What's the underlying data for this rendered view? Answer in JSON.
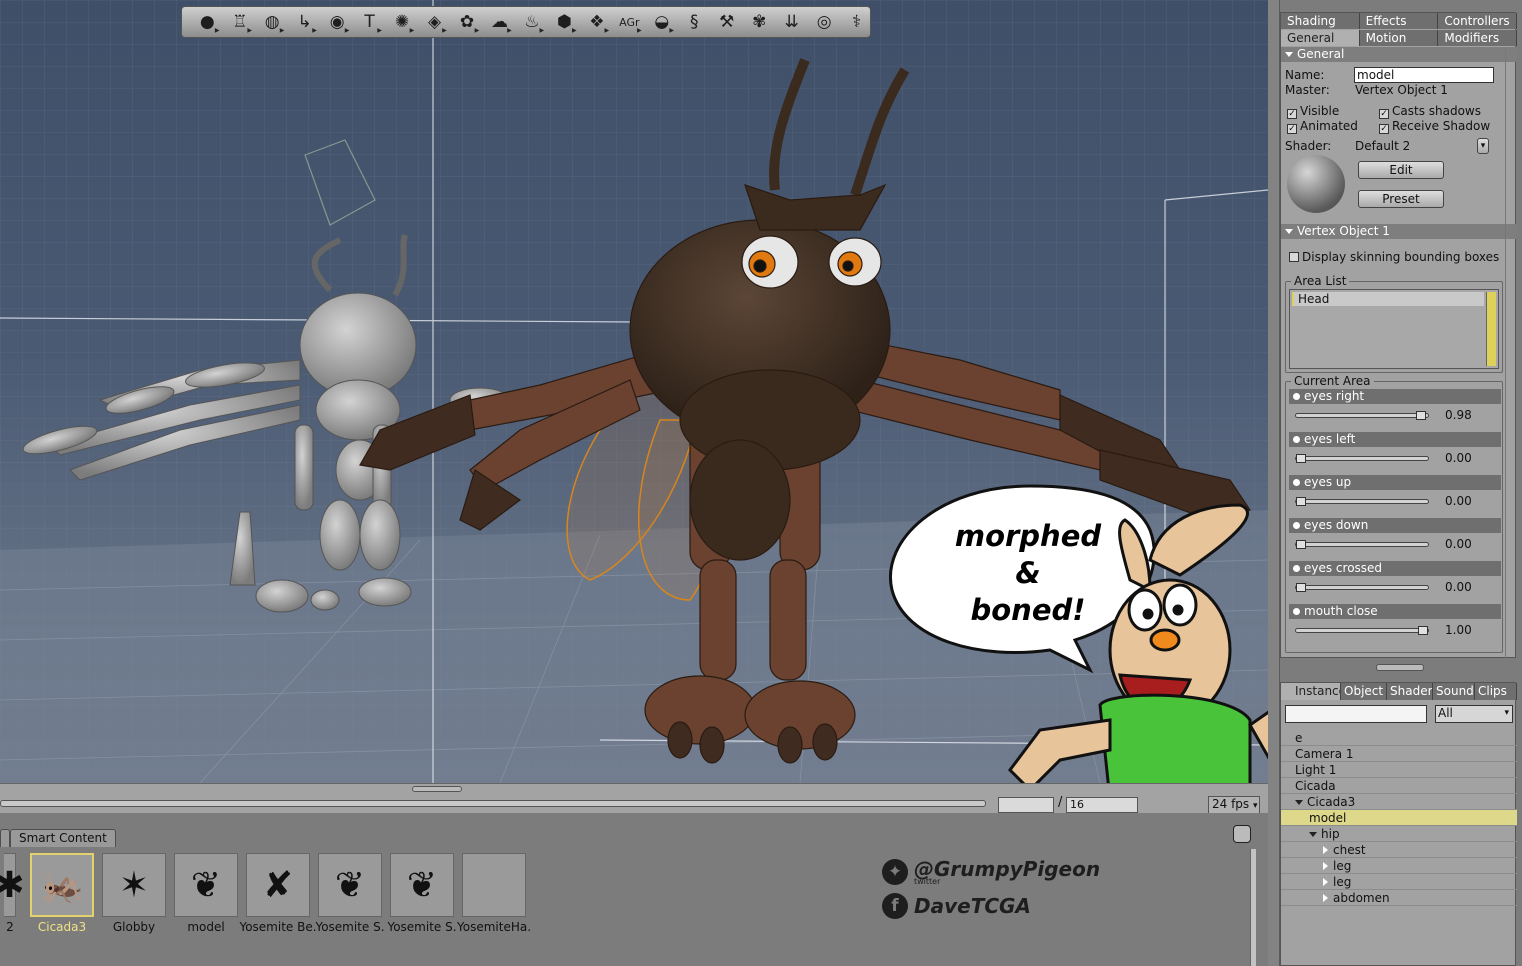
{
  "toolbar": {
    "tools": [
      {
        "name": "sphere-icon",
        "glyph": "●"
      },
      {
        "name": "goblet-icon",
        "glyph": "♖"
      },
      {
        "name": "globe-icon",
        "glyph": "◍"
      },
      {
        "name": "bend-icon",
        "glyph": "↳"
      },
      {
        "name": "eye-icon",
        "glyph": "◉"
      },
      {
        "name": "text-icon",
        "glyph": "T"
      },
      {
        "name": "gear-icon",
        "glyph": "✺"
      },
      {
        "name": "terrain-icon",
        "glyph": "◈"
      },
      {
        "name": "tree-icon",
        "glyph": "✿"
      },
      {
        "name": "cloud-icon",
        "glyph": "☁"
      },
      {
        "name": "flame-icon",
        "glyph": "♨"
      },
      {
        "name": "dice-icon",
        "glyph": "⬢"
      },
      {
        "name": "diamond-icon",
        "glyph": "❖"
      },
      {
        "name": "agr-icon",
        "glyph": "AGr"
      },
      {
        "name": "bowl-icon",
        "glyph": "◒"
      },
      {
        "name": "spring-icon",
        "glyph": "§"
      },
      {
        "name": "hammer-icon",
        "glyph": "⚒"
      },
      {
        "name": "flower-icon",
        "glyph": "✾"
      },
      {
        "name": "arrows-icon",
        "glyph": "⇊"
      },
      {
        "name": "target-icon",
        "glyph": "◎"
      },
      {
        "name": "bone-icon",
        "glyph": "⚕"
      }
    ]
  },
  "timeline": {
    "frame_value": "16",
    "fps": "24 fps"
  },
  "library": {
    "tab_label": "Smart Content",
    "items": [
      {
        "label": "2",
        "glyph": "✱",
        "selected": false
      },
      {
        "label": "Cicada3",
        "glyph": "🦗",
        "selected": true
      },
      {
        "label": "Globby",
        "glyph": "✶",
        "selected": false
      },
      {
        "label": "model",
        "glyph": "❦",
        "selected": false
      },
      {
        "label": "Yosemite Be.",
        "glyph": "✘",
        "selected": false
      },
      {
        "label": "Yosemite S.",
        "glyph": "❦",
        "selected": false
      },
      {
        "label": "Yosemite S.",
        "glyph": "❦",
        "selected": false
      },
      {
        "label": "YosemiteHa.",
        "glyph": "",
        "selected": false
      }
    ]
  },
  "watermark": {
    "twitter": "@GrumpyPigeon",
    "twitter_sub": "twitter",
    "facebook": "DaveTCGA"
  },
  "bubble": {
    "line1": "morphed",
    "line2": "&",
    "line3": "boned!"
  },
  "properties": {
    "tabs_row1": [
      "Shading",
      "Effects",
      "Controllers"
    ],
    "tabs_row2": [
      "General",
      "Motion",
      "Modifiers"
    ],
    "general_header": "General",
    "name_label": "Name:",
    "name_value": "model",
    "master_label": "Master:",
    "master_value": "Vertex Object 1",
    "visible": "Visible",
    "casts_shadows": "Casts shadows",
    "animated": "Animated",
    "receive_shadow": "Receive Shadow",
    "shader_label": "Shader:",
    "shader_value": "Default 2",
    "edit_btn": "Edit",
    "preset_btn": "Preset",
    "vertex_header": "Vertex Object 1",
    "display_skinning": "Display skinning bounding boxes",
    "area_list_title": "Area List",
    "area_list_item": "Head",
    "current_area_title": "Current Area",
    "morphs": [
      {
        "name": "eyes right",
        "value": "0.98",
        "level": 0.98
      },
      {
        "name": "eyes left",
        "value": "0.00",
        "level": 0.0
      },
      {
        "name": "eyes up",
        "value": "0.00",
        "level": 0.0
      },
      {
        "name": "eyes down",
        "value": "0.00",
        "level": 0.0
      },
      {
        "name": "eyes crossed",
        "value": "0.00",
        "level": 0.0
      },
      {
        "name": "mouth close",
        "value": "1.00",
        "level": 1.0
      }
    ]
  },
  "instances": {
    "tabs": [
      "Instance",
      "Object",
      "Shader",
      "Sound",
      "Clips"
    ],
    "filter_value": "All",
    "tree": [
      {
        "label": "e",
        "indent": 0,
        "arrow": "none",
        "selected": false
      },
      {
        "label": "Camera 1",
        "indent": 0,
        "arrow": "none",
        "selected": false
      },
      {
        "label": "Light 1",
        "indent": 0,
        "arrow": "none",
        "selected": false
      },
      {
        "label": "Cicada",
        "indent": 0,
        "arrow": "none",
        "selected": false
      },
      {
        "label": "Cicada3",
        "indent": 0,
        "arrow": "down",
        "selected": false
      },
      {
        "label": "model",
        "indent": 1,
        "arrow": "none",
        "selected": true
      },
      {
        "label": "hip",
        "indent": 1,
        "arrow": "down",
        "selected": false
      },
      {
        "label": "chest",
        "indent": 2,
        "arrow": "right",
        "selected": false
      },
      {
        "label": "leg",
        "indent": 2,
        "arrow": "right",
        "selected": false
      },
      {
        "label": "leg",
        "indent": 2,
        "arrow": "right",
        "selected": false
      },
      {
        "label": "abdomen",
        "indent": 2,
        "arrow": "right",
        "selected": false
      }
    ]
  }
}
